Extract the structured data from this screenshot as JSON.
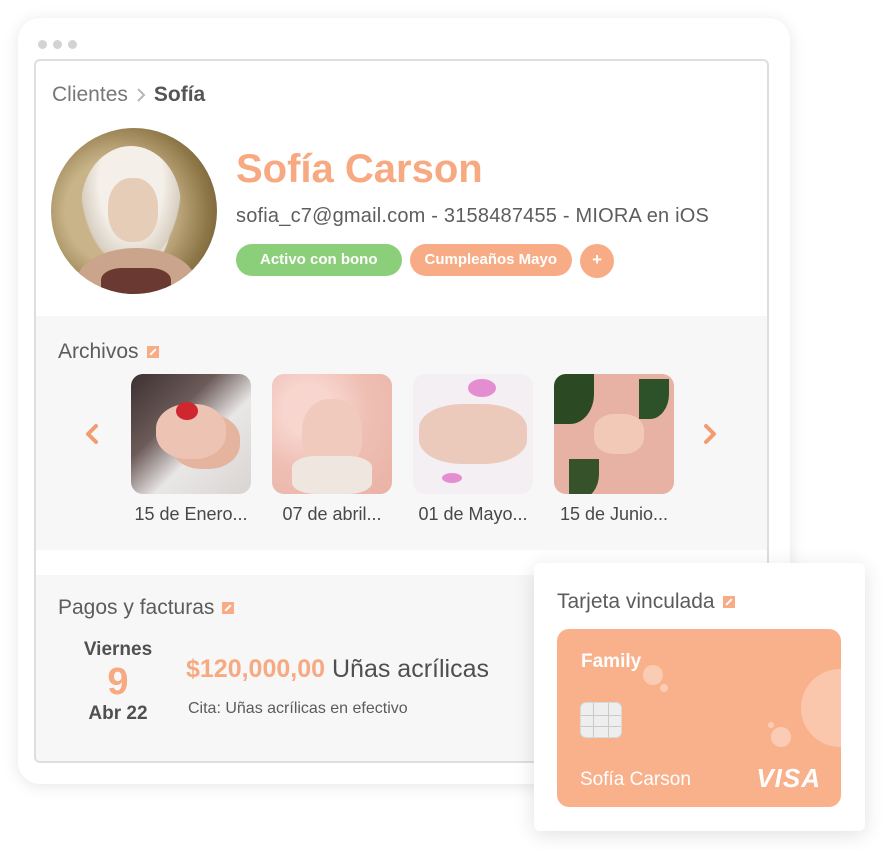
{
  "breadcrumb": {
    "root": "Clientes",
    "current": "Sofía"
  },
  "client": {
    "name": "Sofía Carson",
    "contact": "sofia_c7@gmail.com - 3158487455 - MIORA en iOS",
    "tags": [
      "Activo con bono",
      "Cumpleaños Mayo"
    ],
    "add_tag_label": "+"
  },
  "archivos": {
    "title": "Archivos",
    "prev_icon": "chevron-left-icon",
    "next_icon": "chevron-right-icon",
    "items": [
      {
        "caption": "15 de Enero..."
      },
      {
        "caption": "07 de abril..."
      },
      {
        "caption": "01 de Mayo..."
      },
      {
        "caption": "15 de Junio..."
      }
    ]
  },
  "pagos": {
    "title": "Pagos y facturas",
    "entry": {
      "day": "Viernes",
      "number": "9",
      "month": "Abr 22",
      "amount": "$120,000,00",
      "service": "Uñas acrílicas",
      "note": "Cita: Uñas acrílicas en efectivo"
    }
  },
  "card": {
    "title": "Tarjeta vinculada",
    "label": "Family",
    "holder": "Sofía Carson",
    "network": "VISA"
  },
  "colors": {
    "accent": "#f7a981",
    "tag_green": "#8ccf7a",
    "panel_bg": "#f7f7f7"
  }
}
